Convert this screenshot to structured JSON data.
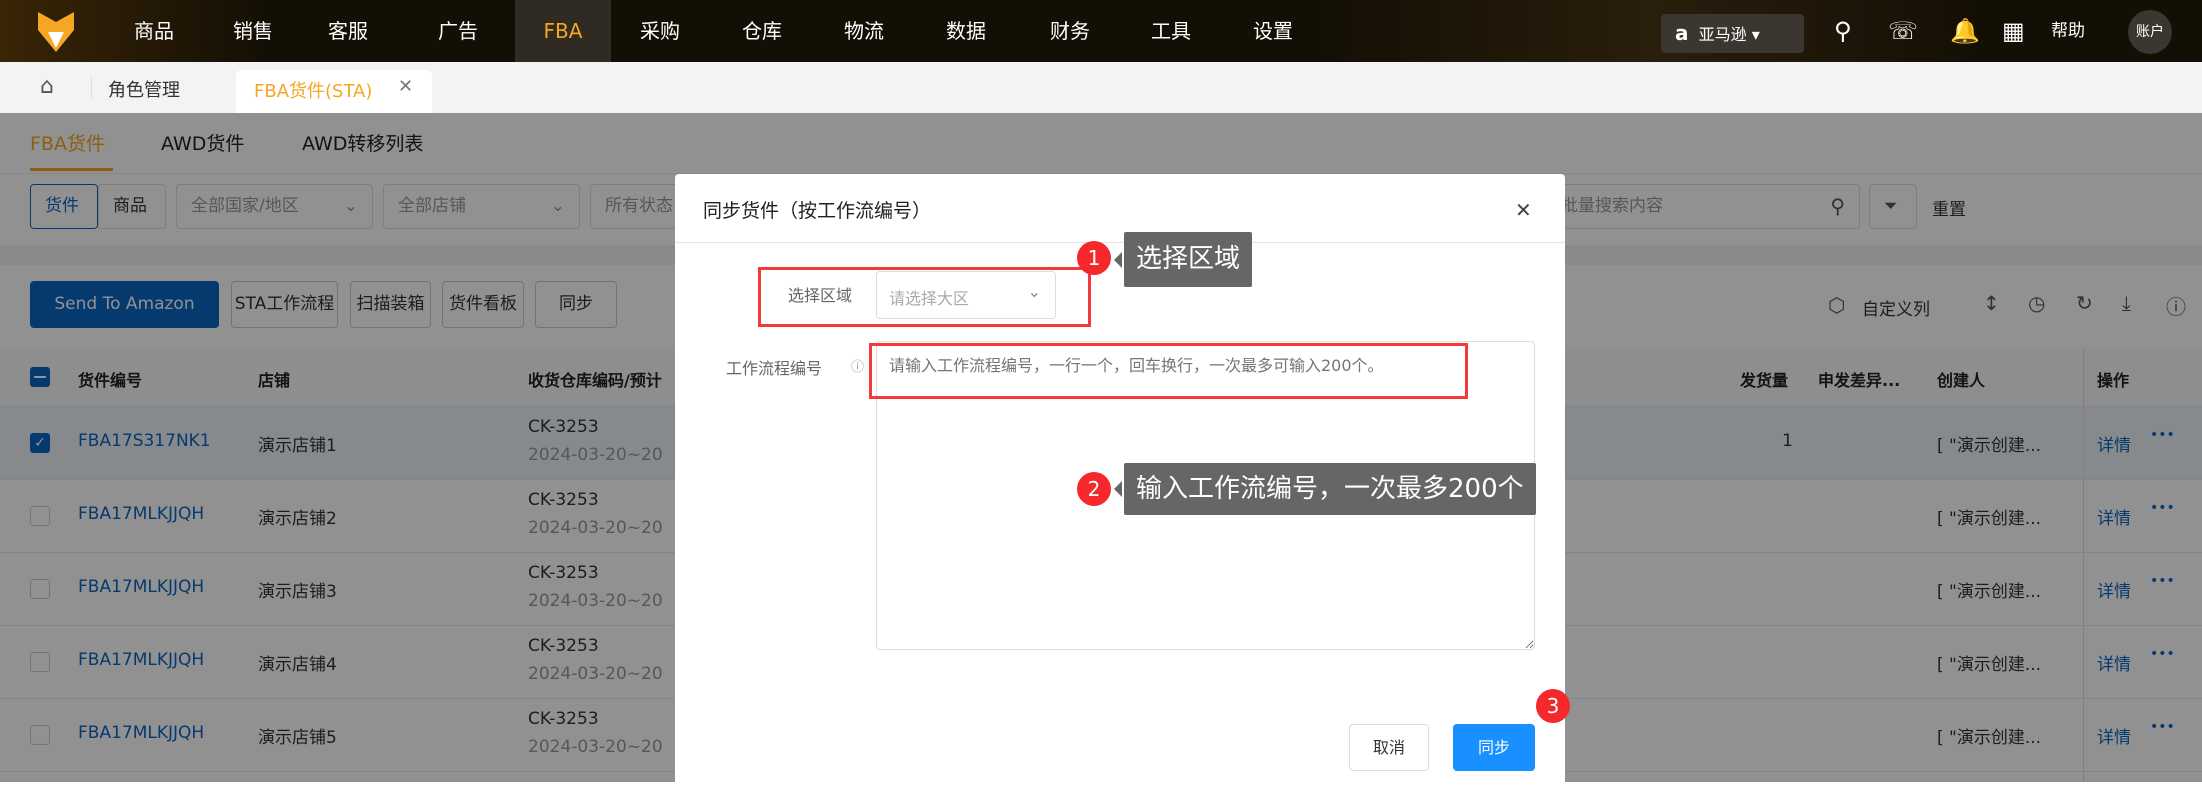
{
  "nav": {
    "items": [
      "商品",
      "销售",
      "客服",
      "广告",
      "FBA",
      "采购",
      "仓库",
      "物流",
      "数据",
      "财务",
      "工具",
      "设置"
    ],
    "active": "FBA",
    "platform": "亚马逊",
    "help": "帮助",
    "account": "账户",
    "accent": "#f5a623"
  },
  "tabs": {
    "items": [
      {
        "label": "角色管理"
      },
      {
        "label": "FBA货件(STA)",
        "active": true
      }
    ]
  },
  "subtabs": [
    "FBA货件",
    "AWD货件",
    "AWD转移列表"
  ],
  "filters": {
    "seg": [
      "货件",
      "商品"
    ],
    "country": "全部国家/地区",
    "shop": "全部店铺",
    "status": "所有状态",
    "search_placeholder": "可批量搜索内容",
    "reset": "重置"
  },
  "toolbar": {
    "send": "Send To Amazon",
    "buttons": [
      "STA工作流程",
      "扫描装箱",
      "货件看板",
      "同步"
    ],
    "custom_cols": "自定义列"
  },
  "table": {
    "headers": [
      "货件编号",
      "店铺",
      "收货仓库编码/预计",
      "发货量",
      "申发差异...",
      "创建人",
      "操作"
    ],
    "rows": [
      {
        "id": "FBA17S317NK1",
        "shop": "演示店铺1",
        "wh": "CK-3253",
        "date": "2024-03-20~20",
        "qty": "1",
        "creator": "[ \"演示创建...",
        "checked": true
      },
      {
        "id": "FBA17MLKJJQH",
        "shop": "演示店铺2",
        "wh": "CK-3253",
        "date": "2024-03-20~20",
        "qty": "",
        "creator": "[ \"演示创建...",
        "checked": false
      },
      {
        "id": "FBA17MLKJJQH",
        "shop": "演示店铺3",
        "wh": "CK-3253",
        "date": "2024-03-20~20",
        "qty": "",
        "creator": "[ \"演示创建...",
        "checked": false
      },
      {
        "id": "FBA17MLKJJQH",
        "shop": "演示店铺4",
        "wh": "CK-3253",
        "date": "2024-03-20~20",
        "qty": "",
        "creator": "[ \"演示创建...",
        "checked": false
      },
      {
        "id": "FBA17MLKJJQH",
        "shop": "演示店铺5",
        "wh": "CK-3253",
        "date": "2024-03-20~20",
        "qty": "",
        "creator": "[ \"演示创建...",
        "checked": false
      }
    ],
    "detail": "详情",
    "more": "•••"
  },
  "modal": {
    "title": "同步货件（按工作流编号）",
    "region_label": "选择区域",
    "region_placeholder": "请选择大区",
    "workflow_label": "工作流程编号",
    "workflow_placeholder": "请输入工作流程编号，一行一个，回车换行，一次最多可输入200个。",
    "cancel": "取消",
    "confirm": "同步"
  },
  "annotations": [
    {
      "num": "1",
      "text": "选择区域"
    },
    {
      "num": "2",
      "text": "输入工作流编号，一次最多200个"
    },
    {
      "num": "3"
    }
  ]
}
